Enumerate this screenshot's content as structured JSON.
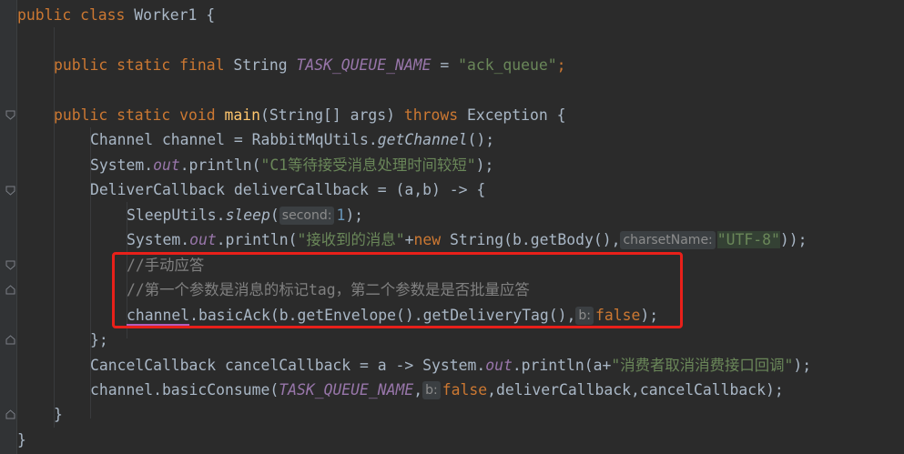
{
  "code": {
    "l1": {
      "kw": "public class ",
      "name": "Worker1 {"
    },
    "l3": {
      "kw": "public static final ",
      "type": "String ",
      "const": "TASK_QUEUE_NAME",
      "eq": " = ",
      "str": "\"ack_queue\"",
      "semi": ";"
    },
    "l5": {
      "kw": "public static void ",
      "fn": "main",
      "args": "(String[] args) ",
      "throws": "throws ",
      "exc": "Exception {"
    },
    "l6": {
      "a": "Channel channel = RabbitMqUtils.",
      "m": "getChannel",
      "b": "();"
    },
    "l7": {
      "a": "System.",
      "f": "out",
      "b": ".println(",
      "str": "\"C1等待接受消息处理时间较短\"",
      "c": ");"
    },
    "l8": {
      "a": "DeliverCallback deliverCallback = (a,b) -> {"
    },
    "l9": {
      "a": "SleepUtils.",
      "m": "sleep",
      "b": "(",
      "hint": "second:",
      "num": "1",
      "c": ");"
    },
    "l10": {
      "a": "System.",
      "f": "out",
      "b": ".println(",
      "str": "\"接收到的消息\"",
      "plus": "+",
      "kwnew": "new ",
      "c": "String(b.getBody(),",
      "hint": "charsetName:",
      "str2": "\"UTF-8\"",
      "d": "));"
    },
    "l11": {
      "comment": "//手动应答"
    },
    "l12": {
      "comment": "//第一个参数是消息的标记tag，第二个参数是是否批量应答"
    },
    "l13": {
      "var": "channel",
      "a": ".basicAck(b.getEnvelope().getDeliveryTag(),",
      "hint": "b:",
      "kw": "false",
      "c": ");"
    },
    "l14": {
      "a": "};"
    },
    "l15": {
      "a": "CancelCallback cancelCallback = a -> System.",
      "f": "out",
      "b": ".println(a+",
      "str": "\"消费者取消消费接口回调\"",
      "c": ");"
    },
    "l16": {
      "a": "channel.basicConsume(",
      "const": "TASK_QUEUE_NAME",
      "comma": ",",
      "hint": "b:",
      "kw": "false",
      "c": ",deliverCallback,cancelCallback);"
    },
    "l17": {
      "a": "}"
    },
    "l18": {
      "a": "}"
    }
  }
}
